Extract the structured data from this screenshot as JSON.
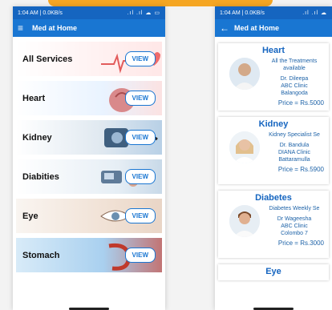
{
  "left": {
    "status": {
      "time": "1:04 AM | 0.0KB/s",
      "icons": ".ıl .ıl ☁ ▭"
    },
    "appbar": {
      "title": "Med at Home",
      "menu_icon": "≡"
    },
    "services": [
      {
        "name": "All Services",
        "button": "VIEW"
      },
      {
        "name": "Heart",
        "button": "VIEW"
      },
      {
        "name": "Kidney",
        "button": "VIEW"
      },
      {
        "name": "Diabities",
        "button": "VIEW"
      },
      {
        "name": "Eye",
        "button": "VIEW"
      },
      {
        "name": "Stomach",
        "button": "VIEW"
      }
    ]
  },
  "right": {
    "status": {
      "time": "1:04 AM | 0.0KB/s",
      "icons": ".ıl .ıl ☁"
    },
    "appbar": {
      "title": "Med at Home",
      "back_icon": "←"
    },
    "cards": [
      {
        "title": "Heart",
        "desc": "All the Treatments available",
        "doctor": "Dr. Dileepa",
        "clinic": "ABC Clinic",
        "location": "Balangoda",
        "price": "Price = Rs.5000"
      },
      {
        "title": "Kidney",
        "desc": "Kidney Specialist Se",
        "doctor": "Dr. Bandula",
        "clinic": "DIANA Clinic",
        "location": "Battaramulla",
        "price": "Price = Rs.5900"
      },
      {
        "title": "Diabetes",
        "desc": "Diabetes Weekly Se",
        "doctor": "Dr Wageesha",
        "clinic": "ABC Clinic",
        "location": "Colombo 7",
        "price": "Price = Rs.3000"
      },
      {
        "title": "Eye"
      }
    ]
  },
  "colors": {
    "primary": "#1976d2",
    "status": "#1565c0",
    "accent": "#f5a623",
    "card_text": "#1e63a8"
  }
}
